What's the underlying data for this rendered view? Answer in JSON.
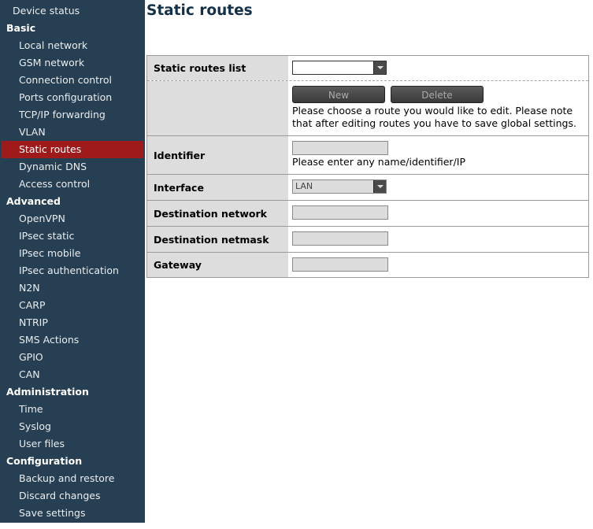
{
  "sidebar": {
    "top_item": "Device status",
    "sections": [
      {
        "title": "Basic",
        "items": [
          "Local network",
          "GSM network",
          "Connection control",
          "Ports configuration",
          "TCP/IP forwarding",
          "VLAN",
          "Static routes",
          "Dynamic DNS",
          "Access control"
        ]
      },
      {
        "title": "Advanced",
        "items": [
          "OpenVPN",
          "IPsec static",
          "IPsec mobile",
          "IPsec authentication",
          "N2N",
          "CARP",
          "NTRIP",
          "SMS Actions",
          "GPIO",
          "CAN"
        ]
      },
      {
        "title": "Administration",
        "items": [
          "Time",
          "Syslog",
          "User files"
        ]
      },
      {
        "title": "Configuration",
        "items": [
          "Backup and restore",
          "Discard changes",
          "Save settings"
        ]
      }
    ],
    "active_item": "Static routes"
  },
  "page": {
    "title": "Static routes"
  },
  "form": {
    "static_routes_list": {
      "label": "Static routes list",
      "value": ""
    },
    "buttons": {
      "new": "New",
      "delete": "Delete"
    },
    "routes_hint": "Please choose a route you would like to edit. Please note that after editing routes you have to save global settings.",
    "identifier": {
      "label": "Identifier",
      "value": "",
      "hint": "Please enter any name/identifier/IP"
    },
    "interface": {
      "label": "Interface",
      "value": "LAN"
    },
    "destination_network": {
      "label": "Destination network",
      "value": ""
    },
    "destination_netmask": {
      "label": "Destination netmask",
      "value": ""
    },
    "gateway": {
      "label": "Gateway",
      "value": ""
    }
  },
  "colors": {
    "sidebar_bg": "#273f52",
    "active_item_bg": "#9f1a1a",
    "title_color": "#13314a"
  }
}
